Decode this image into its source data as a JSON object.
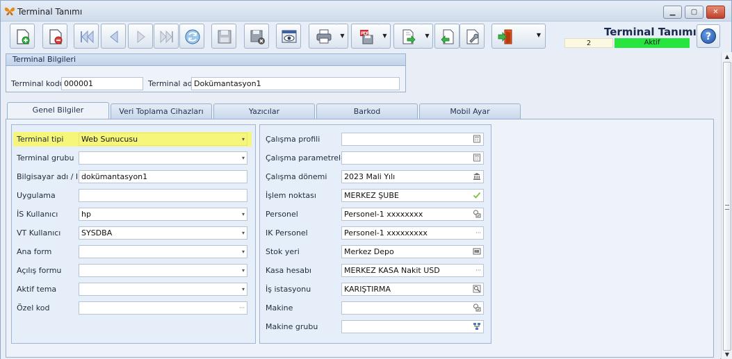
{
  "window": {
    "title": "Terminal Tanımı",
    "minimize_glyph": "▁",
    "maximize_glyph": "▢",
    "close_glyph": "✕"
  },
  "toolbar": {
    "icons": [
      "new-document-icon",
      "delete-document-icon",
      "first-record-icon",
      "previous-record-icon",
      "next-record-icon",
      "last-record-icon",
      "refresh-icon",
      "save-icon",
      "cancel-save-icon",
      "preview-icon",
      "print-icon",
      "pdf-export-icon",
      "export-icon",
      "import-icon",
      "settings-icon",
      "exit-icon",
      "help-icon"
    ],
    "dropdown_glyph": "▼"
  },
  "header": {
    "title": "Terminal Tanımı",
    "record_number": "2",
    "status": "Aktif",
    "status_color": "#27e43e"
  },
  "terminal_info": {
    "group_title": "Terminal Bilgileri",
    "code_label": "Terminal kodu",
    "code_value": "000001",
    "name_label": "Terminal adı",
    "name_value": "Dokümantasyon1"
  },
  "tabs": [
    {
      "label": "Genel Bilgiler",
      "active": true
    },
    {
      "label": "Veri Toplama Cihazları",
      "active": false
    },
    {
      "label": "Yazıcılar",
      "active": false
    },
    {
      "label": "Barkod",
      "active": false
    },
    {
      "label": "Mobil Ayar",
      "active": false
    }
  ],
  "left_form": [
    {
      "label": "Terminal tipi",
      "value": "Web Sunucusu",
      "trail": "▾",
      "highlight": true
    },
    {
      "label": "Terminal grubu",
      "value": "",
      "trail": "▾"
    },
    {
      "label": "Bilgisayar adı / IP",
      "value": "dokümantasyon1",
      "trail": ""
    },
    {
      "label": "Uygulama",
      "value": "",
      "trail": ""
    },
    {
      "label": "İS Kullanıcı",
      "value": "hp",
      "trail": "▾"
    },
    {
      "label": "VT Kullanıcı",
      "value": "SYSDBA",
      "trail": "▾"
    },
    {
      "label": "Ana form",
      "value": "",
      "trail": "▾"
    },
    {
      "label": "Açılış formu",
      "value": "",
      "trail": "▾"
    },
    {
      "label": "Aktif tema",
      "value": "",
      "trail": "▾"
    },
    {
      "label": "Özel kod",
      "value": "",
      "trail": "···"
    }
  ],
  "right_form": [
    {
      "label": "Çalışma profili",
      "value": "",
      "icon": "calculator-icon"
    },
    {
      "label": "Çalışma parametreleri",
      "value": "",
      "icon": "calculator-icon"
    },
    {
      "label": "Çalışma dönemi",
      "value": "2023 Mali Yılı",
      "icon": "bank-icon"
    },
    {
      "label": "İşlem noktası",
      "value": "MERKEZ ŞUBE",
      "icon": "check-icon"
    },
    {
      "label": "Personel",
      "value": "Personel-1 xxxxxxxx",
      "icon": "lookup-icon"
    },
    {
      "label": "IK Personel",
      "value": "Personel-1 xxxxxxxxx",
      "icon": "ellipsis-icon"
    },
    {
      "label": "Stok yeri",
      "value": "Merkez Depo",
      "icon": "barcode-icon"
    },
    {
      "label": "Kasa hesabı",
      "value": "MERKEZ KASA Nakit USD",
      "icon": "ellipsis-icon"
    },
    {
      "label": "İş istasyonu",
      "value": "KARIŞTIRMA",
      "icon": "search-icon"
    },
    {
      "label": "Makine",
      "value": "",
      "icon": "lookup-icon"
    },
    {
      "label": "Makine grubu",
      "value": "",
      "icon": "tree-icon"
    }
  ],
  "scrollbar": {
    "up": "▲",
    "down": "▼"
  }
}
